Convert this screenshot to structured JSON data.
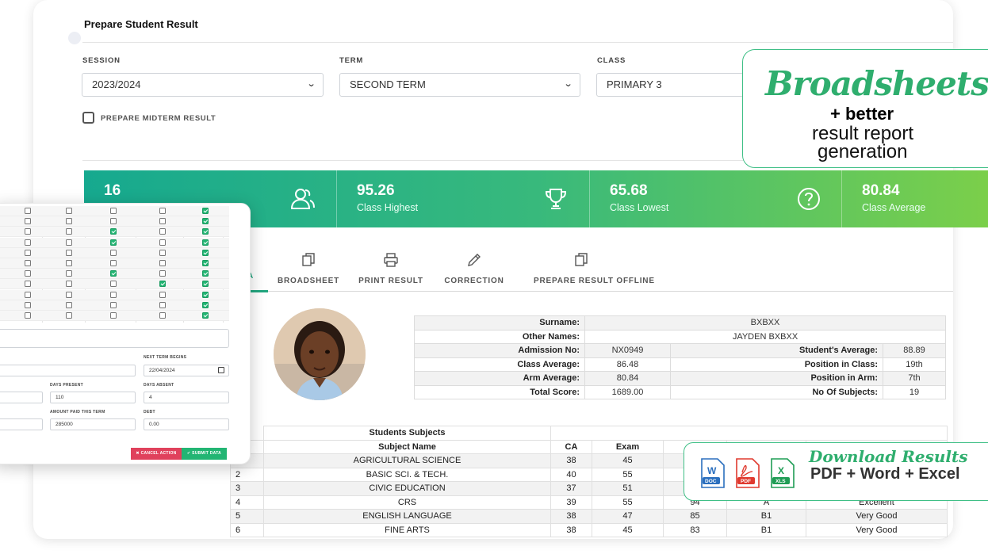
{
  "page_title": "Prepare Student Result",
  "filters": {
    "session_label": "SESSION",
    "session_value": "2023/2024",
    "term_label": "TERM",
    "term_value": "SECOND TERM",
    "class_label": "CLASS",
    "class_value": "PRIMARY 3",
    "midterm_label": "PREPARE MIDTERM RESULT"
  },
  "stats": [
    {
      "value": "16",
      "label": "",
      "icon": "users-icon"
    },
    {
      "value": "95.26",
      "label": "Class Highest",
      "icon": "trophy-icon"
    },
    {
      "value": "65.68",
      "label": "Class Lowest",
      "icon": "question-circle-icon"
    },
    {
      "value": "80.84",
      "label": "Class Average",
      "icon": ""
    }
  ],
  "tabs": {
    "active_fragment": "A",
    "broadsheet": "BROADSHEET",
    "print_result": "PRINT RESULT",
    "correction": "CORRECTION",
    "prepare_offline": "PREPARE RESULT OFFLINE"
  },
  "student": {
    "surname_label": "Surname:",
    "surname": "BXBXX",
    "other_names_label": "Other Names:",
    "other_names": "JAYDEN BXBXX",
    "admission_label": "Admission No:",
    "admission": "NX0949",
    "student_avg_label": "Student's Average:",
    "student_avg": "88.89",
    "class_avg_label": "Class Average:",
    "class_avg": "86.48",
    "pos_class_label": "Position in Class:",
    "pos_class": "19th",
    "arm_avg_label": "Arm Average:",
    "arm_avg": "80.84",
    "pos_arm_label": "Position in Arm:",
    "pos_arm": "7th",
    "total_label": "Total Score:",
    "total": "1689.00",
    "num_subj_label": "No Of Subjects:",
    "num_subj": "19"
  },
  "subjects": {
    "section_title": "Students Subjects",
    "headers": {
      "sn": "N",
      "name": "Subject Name",
      "ca": "CA",
      "exam": "Exam"
    },
    "rows": [
      {
        "sn": "1",
        "name": "AGRICULTURAL SCIENCE",
        "ca": "38",
        "exam": "45",
        "total": "",
        "grade": "",
        "remark": ""
      },
      {
        "sn": "2",
        "name": "BASIC SCI. & TECH.",
        "ca": "40",
        "exam": "55",
        "total": "",
        "grade": "",
        "remark": ""
      },
      {
        "sn": "3",
        "name": "CIVIC EDUCATION",
        "ca": "37",
        "exam": "51",
        "total": "",
        "grade": "",
        "remark": ""
      },
      {
        "sn": "4",
        "name": "CRS",
        "ca": "39",
        "exam": "55",
        "total": "94",
        "grade": "A",
        "remark": "Excellent"
      },
      {
        "sn": "5",
        "name": "ENGLISH LANGUAGE",
        "ca": "38",
        "exam": "47",
        "total": "85",
        "grade": "B1",
        "remark": "Very Good"
      },
      {
        "sn": "6",
        "name": "FINE ARTS",
        "ca": "38",
        "exam": "45",
        "total": "83",
        "grade": "B1",
        "remark": "Very Good"
      }
    ]
  },
  "form": {
    "checkbox_grid": [
      [
        0,
        0,
        0,
        0,
        1
      ],
      [
        0,
        0,
        0,
        0,
        1
      ],
      [
        0,
        0,
        1,
        0,
        1
      ],
      [
        0,
        0,
        1,
        0,
        1
      ],
      [
        0,
        0,
        0,
        0,
        1
      ],
      [
        0,
        0,
        0,
        0,
        1
      ],
      [
        0,
        0,
        1,
        0,
        1
      ],
      [
        0,
        0,
        0,
        1,
        1
      ],
      [
        0,
        0,
        0,
        0,
        1
      ],
      [
        0,
        0,
        0,
        0,
        1
      ],
      [
        0,
        0,
        0,
        0,
        1
      ]
    ],
    "next_term_label": "NEXT TERM BEGINS",
    "next_term_value": "22/04/2024",
    "days_present_label": "DAYS PRESENT",
    "days_present_value": "110",
    "days_absent_label": "DAYS ABSENT",
    "days_absent_value": "4",
    "amount_paid_label": "AMOUNT PAID THIS TERM",
    "amount_paid_value": "285000",
    "debt_label": "DEBT",
    "debt_value": "0.00",
    "cancel_label": "✖ CANCEL ACTION",
    "submit_label": "✔ SUBMIT DATA"
  },
  "promo_broadsheets": {
    "script": "Broadsheets",
    "better": "+ better",
    "line1": "result report",
    "line2": "generation"
  },
  "promo_download": {
    "script": "Download Results",
    "formats": "PDF + Word + Excel",
    "icons": [
      {
        "letter": "W",
        "tag": "DOC",
        "color": "#2b6fbe"
      },
      {
        "letter": "PDF",
        "tag": "PDF",
        "color": "#e03a2f"
      },
      {
        "letter": "X",
        "tag": "XLS",
        "color": "#1f9d55"
      }
    ]
  },
  "colors": {
    "accent": "#22a67f",
    "gradient_start": "#16a98f",
    "gradient_end": "#7bcf4a",
    "cancel": "#e0415c",
    "submit": "#22b573"
  }
}
